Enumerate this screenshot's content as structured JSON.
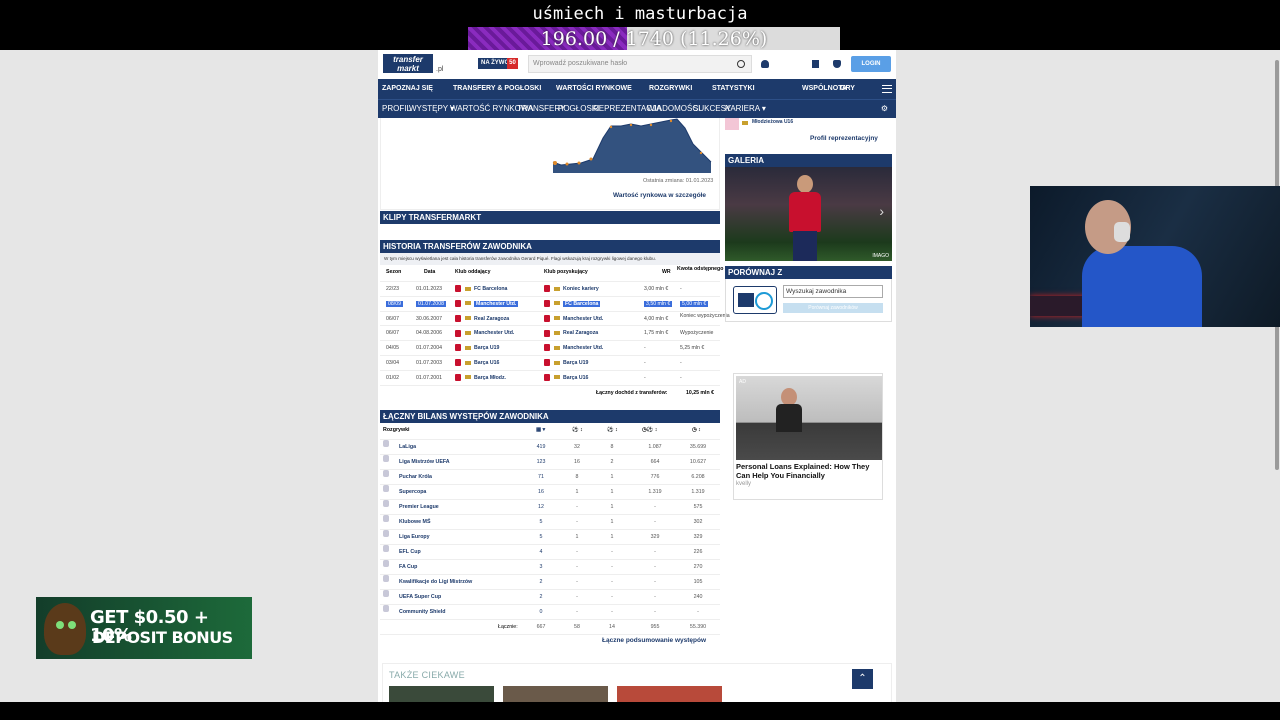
{
  "overlay": {
    "title": "uśmiech i masturbacja",
    "goal_text": "196.00 / 1740 (11.26%)",
    "goal_fraction": 0.1126
  },
  "header": {
    "logo_line1": "transfer",
    "logo_line2": "markt",
    "domain_suffix": ".pl",
    "live_label": "NA ŻYWO",
    "live_count": "50",
    "search_placeholder": "Wprowadź poszukiwane hasło",
    "login_label": "LOGIN"
  },
  "nav_main": [
    "ZAPOZNAJ SIĘ",
    "TRANSFERY & POGŁOSKI",
    "WARTOŚCI RYNKOWE",
    "ROZGRYWKI",
    "STATYSTYKI",
    "WSPÓLNOTA",
    "GRY"
  ],
  "nav_sub": [
    "PROFIL",
    "WYSTĘPY ▾",
    "WARTOŚĆ RYNKOWA",
    "TRANSFERY",
    "POGŁOSKI",
    "REPREZENTACJA",
    "WIADOMOŚCI",
    "SUKCESY",
    "KARIERA ▾"
  ],
  "value_chart": {
    "last_change": "Ostatnia zmiana: 01.01.2023",
    "details_link": "Wartość rynkowa w szczegółe"
  },
  "clips": {
    "title": "KLIPY TRANSFERMARKT"
  },
  "transfers": {
    "title": "HISTORIA TRANSFERÓW ZAWODNIKA",
    "notice": "W tym miejscu wyświetlana jest cała historia transferów zawodnika Gerard Piqué. Flagi wskazują kraj rozgrywki ligowej danego klubu.",
    "headers": [
      "Sezon",
      "Data",
      "Klub oddający",
      "Klub pozyskujący",
      "WR",
      "Kwota odstępnego"
    ],
    "rows": [
      {
        "season": "22/23",
        "date": "01.01.2023",
        "from": "FC Barcelona",
        "to": "Koniec kariery",
        "mv": "3,00 mln €",
        "fee": "-"
      },
      {
        "season": "08/09",
        "date": "01.07.2008",
        "from": "Manchester Utd.",
        "to": "FC Barcelona",
        "mv": "3,50 mln €",
        "fee": "5,00 mln €"
      },
      {
        "season": "06/07",
        "date": "30.06.2007",
        "from": "Real Zaragoza",
        "to": "Manchester Utd.",
        "mv": "4,00 mln €",
        "fee": "Koniec wypożyczenia"
      },
      {
        "season": "06/07",
        "date": "04.08.2006",
        "from": "Manchester Utd.",
        "to": "Real Zaragoza",
        "mv": "1,75 mln €",
        "fee": "Wypożyczenie"
      },
      {
        "season": "04/05",
        "date": "01.07.2004",
        "from": "Barça U19",
        "to": "Manchester Utd.",
        "mv": "-",
        "fee": "5,25 mln €"
      },
      {
        "season": "03/04",
        "date": "01.07.2003",
        "from": "Barça U16",
        "to": "Barça U19",
        "mv": "-",
        "fee": "-"
      },
      {
        "season": "01/02",
        "date": "01.07.2001",
        "from": "Barça Młodz.",
        "to": "Barça U16",
        "mv": "-",
        "fee": "-"
      }
    ],
    "total_label": "Łączny dochód z transferów:",
    "total_value": "10,25 mln €"
  },
  "appearances": {
    "title": "ŁĄCZNY BILANS WYSTĘPÓW ZAWODNIKA",
    "comp_header": "Rozgrywki",
    "rows": [
      {
        "name": "LaLiga",
        "apps": "419",
        "goals": "32",
        "assists": "8",
        "mpg": "1.087",
        "min": "35.699"
      },
      {
        "name": "Liga Mistrzów UEFA",
        "apps": "123",
        "goals": "16",
        "assists": "2",
        "mpg": "664",
        "min": "10.627"
      },
      {
        "name": "Puchar Króla",
        "apps": "71",
        "goals": "8",
        "assists": "1",
        "mpg": "776",
        "min": "6.208"
      },
      {
        "name": "Supercopa",
        "apps": "16",
        "goals": "1",
        "assists": "1",
        "mpg": "1.319",
        "min": "1.319"
      },
      {
        "name": "Premier League",
        "apps": "12",
        "goals": "-",
        "assists": "1",
        "mpg": "-",
        "min": "575"
      },
      {
        "name": "Klubowe MŚ",
        "apps": "5",
        "goals": "-",
        "assists": "1",
        "mpg": "-",
        "min": "302"
      },
      {
        "name": "Liga Europy",
        "apps": "5",
        "goals": "1",
        "assists": "1",
        "mpg": "329",
        "min": "329"
      },
      {
        "name": "EFL Cup",
        "apps": "4",
        "goals": "-",
        "assists": "-",
        "mpg": "-",
        "min": "226"
      },
      {
        "name": "FA Cup",
        "apps": "3",
        "goals": "-",
        "assists": "-",
        "mpg": "-",
        "min": "270"
      },
      {
        "name": "Kwalifikacje do Ligi Mistrzów",
        "apps": "2",
        "goals": "-",
        "assists": "-",
        "mpg": "-",
        "min": "105"
      },
      {
        "name": "UEFA Super Cup",
        "apps": "2",
        "goals": "-",
        "assists": "-",
        "mpg": "-",
        "min": "240"
      },
      {
        "name": "Community Shield",
        "apps": "0",
        "goals": "-",
        "assists": "-",
        "mpg": "-",
        "min": "-"
      }
    ],
    "total_label": "Łącznie:",
    "totals": {
      "apps": "667",
      "goals": "58",
      "assists": "14",
      "mpg": "955",
      "min": "55.390"
    },
    "summary_link": "Łączne podsumowanie występów"
  },
  "sidebar": {
    "national_item": "Młodzieżowa U16",
    "national_link": "Profil reprezentacyjny",
    "gallery_title": "GALERIA",
    "gallery_credit": "IMAGO",
    "compare_title": "PORÓWNAJ Z",
    "compare_placeholder": "Wyszukaj zawodnika",
    "compare_button": "Porównaj zawodników"
  },
  "ad": {
    "tag": "AD",
    "title": "Personal Loans Explained: How They Can Help You Financially",
    "source": "kvelly"
  },
  "also_interesting": "TAKŻE CIEKAWE",
  "promo": {
    "line1": "GET $0.50 + 10%",
    "line2": "DEPOSIT BONUS"
  }
}
